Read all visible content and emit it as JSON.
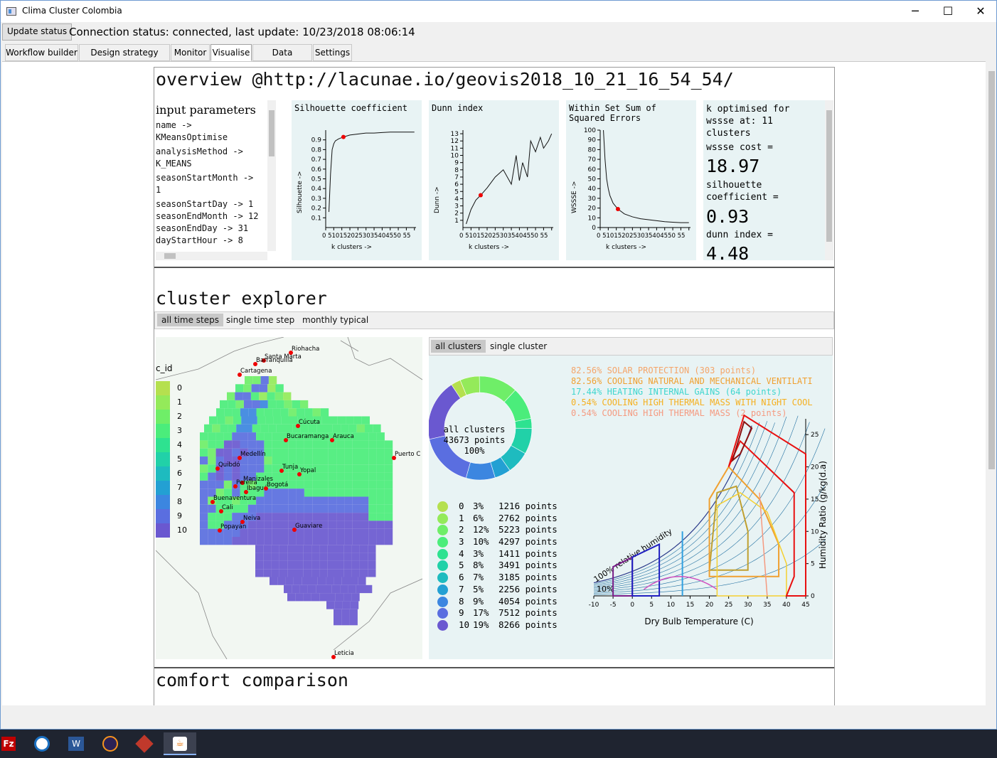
{
  "window": {
    "title": "Clima Cluster Colombia",
    "controls": [
      "─",
      "☐",
      "✕"
    ]
  },
  "status": {
    "update_button": "Update status",
    "text": "Connection status: connected, last update: 10/23/2018 08:06:14"
  },
  "tabs": [
    "Workflow builder",
    "Design strategy editor",
    "Monitor",
    "Visualise",
    "Data manager",
    "Settings"
  ],
  "active_tab": "Visualise",
  "overview": {
    "title": "overview @http://lacunae.io/geovis2018_10_21_16_54_54/",
    "input_params_title": "input parameters",
    "params": [
      "name ->",
      "KMeansOptimise",
      "analysisMethod ->",
      "K_MEANS",
      "seasonStartMonth ->",
      "1",
      "seasonStartDay -> 1",
      "seasonEndMonth -> 12",
      "seasonEndDay -> 31",
      "dayStartHour -> 8"
    ],
    "silhouette_title": "Silhouette coefficient",
    "silhouette_ylabel": "Silhouette ->",
    "dunn_title": "Dunn index",
    "dunn_ylabel": "Dunn ->",
    "wssse_title": "Within Set Sum of Squared Errors",
    "wssse_ylabel": "WSSSE ->",
    "xlabel": "k clusters ->",
    "x_ticks": "0 5101520253035404550 55",
    "summary": {
      "k_text": "k optimised for wssse at: 11 clusters",
      "wssse_label": "wssse cost =",
      "wssse_value": "18.97",
      "silhouette_label": "silhouette coefficient =",
      "silhouette_value": "0.93",
      "dunn_label": "dunn index =",
      "dunn_value": "4.48"
    }
  },
  "cluster_explorer": {
    "title": "cluster explorer",
    "subtabs": [
      "all time steps",
      "single time step",
      "monthly typical"
    ],
    "map_legend_title": "c_id",
    "legend_ids": [
      "0",
      "1",
      "2",
      "3",
      "4",
      "5",
      "6",
      "7",
      "8",
      "9",
      "10"
    ],
    "cities": [
      "Riohacha",
      "Santa Marta",
      "Barranquilla",
      "Cartagena",
      "Cúcuta",
      "Bucaramanga",
      "Arauca",
      "Puerto C",
      "Medellín",
      "Quibdó",
      "Tunja",
      "Yopal",
      "Manizales",
      "Pereira",
      "Ibagué",
      "Bogotá",
      "Buenaventura",
      "Cali",
      "Neiva",
      "Guaviare",
      "Popayán",
      "Leticia"
    ],
    "cluster_tabs": [
      "all clusters",
      "single cluster"
    ],
    "donut_center": [
      "all clusters",
      "43673 points",
      "100%"
    ],
    "clusters": [
      {
        "id": "0",
        "pct": "3%",
        "points": "1216 points",
        "color": "#b5e04f"
      },
      {
        "id": "1",
        "pct": "6%",
        "points": "2762 points",
        "color": "#94ea5a"
      },
      {
        "id": "2",
        "pct": "12%",
        "points": "5223 points",
        "color": "#6fee68"
      },
      {
        "id": "3",
        "pct": "10%",
        "points": "4297 points",
        "color": "#4bed7b"
      },
      {
        "id": "4",
        "pct": "3%",
        "points": "1411 points",
        "color": "#2ee290"
      },
      {
        "id": "5",
        "pct": "8%",
        "points": "3491 points",
        "color": "#21d1a8"
      },
      {
        "id": "6",
        "pct": "7%",
        "points": "3185 points",
        "color": "#1ebbbf"
      },
      {
        "id": "7",
        "pct": "5%",
        "points": "2256 points",
        "color": "#23a0d3"
      },
      {
        "id": "8",
        "pct": "9%",
        "points": "4054 points",
        "color": "#3c86e0"
      },
      {
        "id": "9",
        "pct": "17%",
        "points": "7512 points",
        "color": "#5a6ee0"
      },
      {
        "id": "10",
        "pct": "19%",
        "points": "8266 points",
        "color": "#6a58d0"
      }
    ],
    "strategies": [
      {
        "text": "82.56% SOLAR PROTECTION (303 points)",
        "color": "#f5a56a"
      },
      {
        "text": "82.56% COOLING NATURAL AND MECHANICAL VENTILATI",
        "color": "#f0a030"
      },
      {
        "text": "17.44% HEATING INTERNAL GAINS (64 points)",
        "color": "#3ed6cf"
      },
      {
        "text": "0.54% COOLING HIGH THERMAL MASS WITH NIGHT COOL",
        "color": "#f5b020"
      },
      {
        "text": "0.54% COOLING HIGH THERMAL MASS (2 points)",
        "color": "#f59a80"
      }
    ],
    "psychro": {
      "xlabel": "Dry Bulb Temperature (C)",
      "ylabel": "Humidity Ratio (g/kg(d.a)",
      "x_ticks": [
        "-10",
        "-5",
        "0",
        "5",
        "10",
        "15",
        "20",
        "25",
        "30",
        "35",
        "40",
        "45"
      ],
      "y_ticks": [
        "0",
        "5",
        "10",
        "15",
        "20",
        "25"
      ],
      "rh_100": "100% relative humidity",
      "rh_10": "10%"
    }
  },
  "comfort": {
    "title": "comfort comparison"
  },
  "chart_data": [
    {
      "type": "line",
      "title": "Silhouette coefficient",
      "xlabel": "k clusters ->",
      "ylabel": "Silhouette ->",
      "x": [
        2,
        3,
        4,
        5,
        6,
        8,
        11,
        15,
        20,
        25,
        30,
        35,
        40,
        45,
        50,
        55
      ],
      "y": [
        0.16,
        0.55,
        0.8,
        0.86,
        0.89,
        0.91,
        0.93,
        0.95,
        0.96,
        0.97,
        0.97,
        0.975,
        0.98,
        0.98,
        0.98,
        0.98
      ],
      "highlight": {
        "x": 11,
        "y": 0.93
      },
      "ylim": [
        0,
        1
      ]
    },
    {
      "type": "line",
      "title": "Dunn index",
      "xlabel": "k clusters ->",
      "ylabel": "Dunn ->",
      "x": [
        2,
        5,
        8,
        11,
        15,
        20,
        25,
        30,
        33,
        35,
        37,
        40,
        42,
        45,
        48,
        50,
        53,
        55
      ],
      "y": [
        0.5,
        2.5,
        3.8,
        4.48,
        5.5,
        7,
        8,
        6,
        10,
        6.5,
        9,
        7,
        12,
        10.5,
        12.5,
        11,
        12,
        13
      ],
      "highlight": {
        "x": 11,
        "y": 4.48
      },
      "ylim": [
        0,
        13.5
      ]
    },
    {
      "type": "line",
      "title": "Within Set Sum of Squared Errors",
      "xlabel": "k clusters ->",
      "ylabel": "WSSSE ->",
      "x": [
        2,
        3,
        4,
        5,
        6,
        8,
        11,
        15,
        20,
        25,
        30,
        35,
        40,
        45,
        50,
        55
      ],
      "y": [
        100,
        70,
        50,
        40,
        33,
        25,
        18.97,
        14,
        11,
        9,
        8,
        7,
        6,
        5.5,
        5,
        5
      ],
      "highlight": {
        "x": 11,
        "y": 18.97
      },
      "ylim": [
        0,
        100
      ]
    },
    {
      "type": "pie",
      "title": "all clusters",
      "categories": [
        "0",
        "1",
        "2",
        "3",
        "4",
        "5",
        "6",
        "7",
        "8",
        "9",
        "10"
      ],
      "values": [
        3,
        6,
        12,
        10,
        3,
        8,
        7,
        5,
        9,
        17,
        19
      ]
    }
  ]
}
